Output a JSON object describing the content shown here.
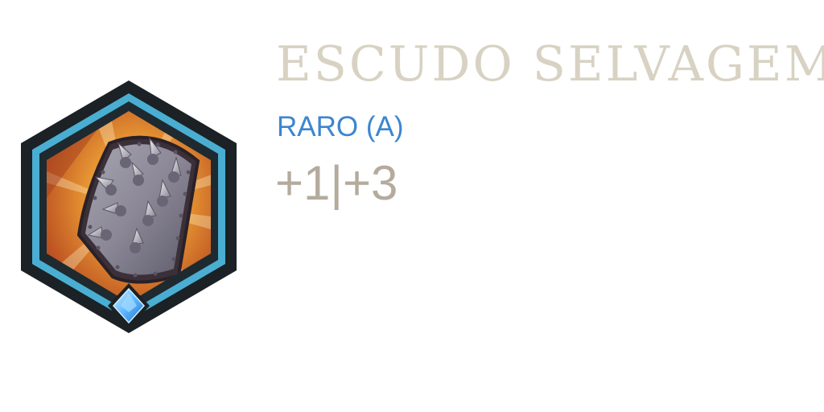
{
  "item": {
    "name": "ESCUDO SELVAGEM",
    "rarity": "RARO (A)",
    "stats": "+1|+3",
    "icon": "spiked-shield-icon",
    "gem": "blue-diamond-gem-icon"
  },
  "colors": {
    "title": "#d8d2c3",
    "rarity": "#3d86cf",
    "stats": "#b4ab9d",
    "frame_dark": "#1b2124",
    "frame_teal": "#4aaed2",
    "background_orange": "#e48a2c",
    "shield_metal": "#8e8d99",
    "gem_blue": "#5fb8ff"
  }
}
